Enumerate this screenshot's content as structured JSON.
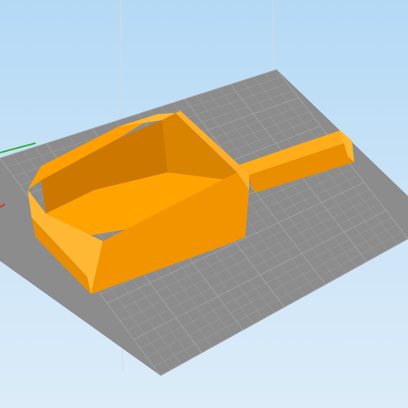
{
  "viewport": {
    "background_top": "#b4d9f5",
    "background_bottom": "#dcecf8",
    "bed_color": "#8a8a8a",
    "grid_line_color": "#a2a2a2",
    "model_color": "#ffa500",
    "model_shade_color": "#e08a00",
    "model_dark_color": "#c87400",
    "axis_x_color": "#e03030",
    "axis_y_color": "#30b030"
  },
  "model": {
    "name_icon": "scoop-model-icon"
  }
}
